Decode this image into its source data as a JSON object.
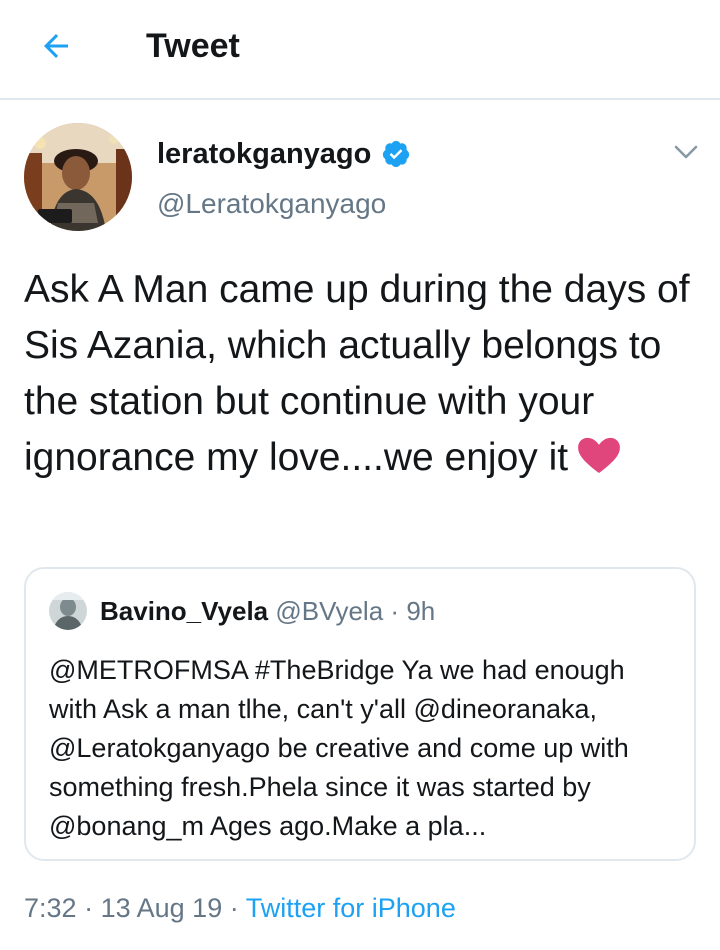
{
  "header": {
    "title": "Tweet",
    "back_icon": "arrow-left-icon"
  },
  "tweet": {
    "author": {
      "name": "leratokganyago",
      "handle": "@Leratokganyago",
      "verified": true
    },
    "text": "Ask A Man came up during the days of Sis Azania, which actually belongs to the station but continue with your ignorance my love....we enjoy it",
    "emoji": "pink-heart-icon",
    "timestamp": "7:32",
    "date": "13 Aug 19",
    "separator": "·",
    "source": "Twitter for iPhone"
  },
  "quoted_tweet": {
    "author": {
      "name": "Bavino_Vyela",
      "handle": "@BVyela"
    },
    "separator": "·",
    "time_ago": "9h",
    "text": "@METROFMSA #TheBridge Ya we had enough with Ask a man tlhe, can't y'all @dineoranaka, @Leratokganyago  be creative and come up with something fresh.Phela since it was started by @bonang_m Ages ago.Make a pla..."
  },
  "colors": {
    "accent": "#1da1f2",
    "primary_text": "#14171a",
    "secondary_text": "#657786",
    "border": "#e1e8ed",
    "heart": "#e0457b"
  }
}
